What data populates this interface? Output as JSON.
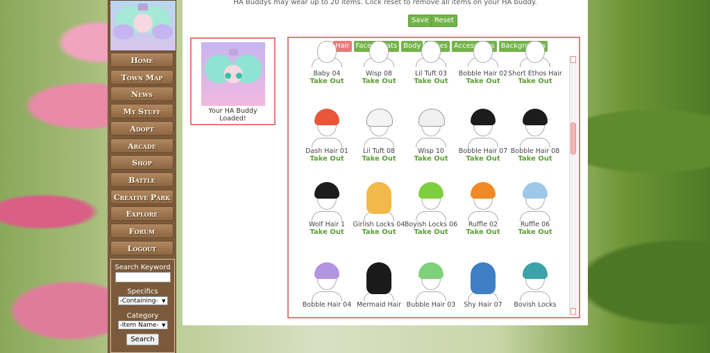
{
  "info": "HA Buddys may wear up to 20 items. Click reset to remove all items on your HA buddy.",
  "actions": {
    "save": "Save",
    "reset": "Reset"
  },
  "buddy": {
    "caption_line1": "Your HA Buddy",
    "caption_line2": "Loaded!"
  },
  "nav": [
    "Home",
    "Town Map",
    "News",
    "My Stuff",
    "Adopt",
    "Arcade",
    "Shop",
    "Battle",
    "Creative Park",
    "Explore",
    "Forum",
    "Logout"
  ],
  "search": {
    "keyword_label": "Search Keyword",
    "keyword_value": "",
    "specifics_label": "Specifics",
    "specifics_value": "-Containing-",
    "category_label": "Category",
    "category_value": "-Item Name-",
    "button": "Search"
  },
  "tabs": [
    "Hair",
    "Faces",
    "Hats",
    "Body",
    "Bases",
    "Accessories",
    "Backgrounds"
  ],
  "active_tab": "Hair",
  "take_out": "Take Out",
  "items": [
    {
      "name": "Baby 04",
      "color": "#ffffff"
    },
    {
      "name": "Wisp 08",
      "color": "#ffffff"
    },
    {
      "name": "Lil Tuft 03",
      "color": "#ffffff"
    },
    {
      "name": "Bobble Hair 02",
      "color": "#ffffff"
    },
    {
      "name": "Short Ethos Hair",
      "color": "#ffffff"
    },
    {
      "name": "Dash Hair 01",
      "color": "#e8573a"
    },
    {
      "name": "Lil Tuft 08",
      "color": "#f4f4f4"
    },
    {
      "name": "Wisp 10",
      "color": "#f0f0f0"
    },
    {
      "name": "Bobble Hair 07",
      "color": "#1c1c1c"
    },
    {
      "name": "Bobble Hair 08",
      "color": "#1c1c1c"
    },
    {
      "name": "Wolf Hair 1",
      "color": "#1c1c1c"
    },
    {
      "name": "Girlish Locks 04",
      "color": "#f2b84a"
    },
    {
      "name": "Boyish Locks 06",
      "color": "#7ccf3f"
    },
    {
      "name": "Ruffle 02",
      "color": "#f08a26"
    },
    {
      "name": "Ruffle 06",
      "color": "#9fc8e8"
    },
    {
      "name": "Bobble Hair 04",
      "color": "#b394de"
    },
    {
      "name": "Mermaid Hair",
      "color": "#1a1a1a"
    },
    {
      "name": "Bubble Hair 03",
      "color": "#7fd17a"
    },
    {
      "name": "Shy Hair 07",
      "color": "#3f7fc4"
    },
    {
      "name": "Bovish Locks",
      "color": "#3aa3a8"
    }
  ]
}
